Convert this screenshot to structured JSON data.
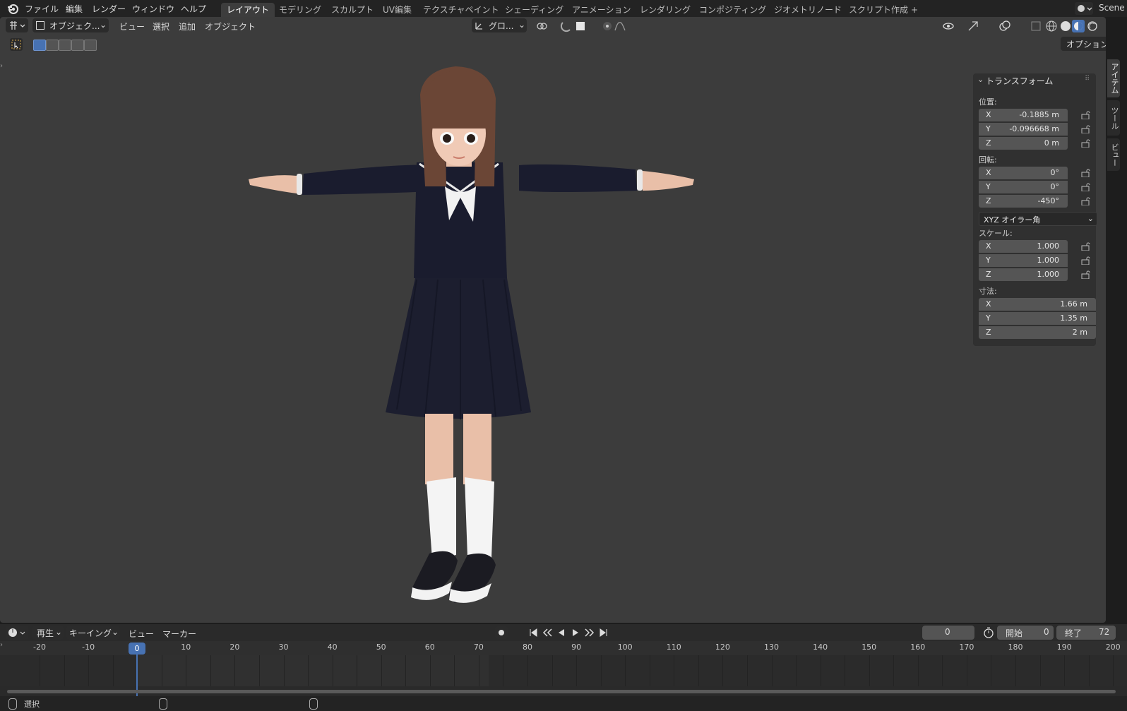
{
  "topbar": {
    "menus": [
      "ファイル",
      "編集",
      "レンダー",
      "ウィンドウ",
      "ヘルプ"
    ],
    "workspaces": [
      "レイアウト",
      "モデリング",
      "スカルプト",
      "UV編集",
      "テクスチャペイント",
      "シェーディング",
      "アニメーション",
      "レンダリング",
      "コンポジティング",
      "ジオメトリノード",
      "スクリプト作成"
    ],
    "active_workspace": "レイアウト",
    "add_tab": "+",
    "scene": "Scene"
  },
  "viewport_header": {
    "mode": "オブジェク...",
    "menus": [
      "ビュー",
      "選択",
      "追加",
      "オブジェクト"
    ],
    "transform_orientation": "グロ...",
    "options_button": "オプション"
  },
  "npanel": {
    "section_title": "トランスフォーム",
    "location": {
      "label": "位置:",
      "x": "-0.1885 m",
      "y": "-0.096668 m",
      "z": "0 m"
    },
    "rotation": {
      "label": "回転:",
      "x": "0°",
      "y": "0°",
      "z": "-450°"
    },
    "rotation_mode": "XYZ オイラー角",
    "scale": {
      "label": "スケール:",
      "x": "1.000",
      "y": "1.000",
      "z": "1.000"
    },
    "dimensions": {
      "label": "寸法:",
      "x": "1.66 m",
      "y": "1.35 m",
      "z": "2 m"
    },
    "axis": {
      "x": "X",
      "y": "Y",
      "z": "Z"
    },
    "side_tabs": [
      "アイテム",
      "ツール",
      "ビュー"
    ]
  },
  "timeline": {
    "menus": [
      "再生",
      "キーイング",
      "ビュー",
      "マーカー"
    ],
    "current_frame": "0",
    "start_label": "開始",
    "start_value": "0",
    "end_label": "終了",
    "end_value": "72",
    "ruler": [
      "-20",
      "-10",
      "0",
      "10",
      "20",
      "30",
      "40",
      "50",
      "60",
      "70",
      "80",
      "90",
      "100",
      "110",
      "120",
      "130",
      "140",
      "150",
      "160",
      "170",
      "180",
      "190",
      "200"
    ],
    "playhead_label": "0"
  },
  "statusbar": {
    "select_label": "選択"
  },
  "colors": {
    "accent": "#4772b3",
    "uniform": "#1a1c2e",
    "skin": "#e9bfa8",
    "hair": "#6b4636"
  }
}
